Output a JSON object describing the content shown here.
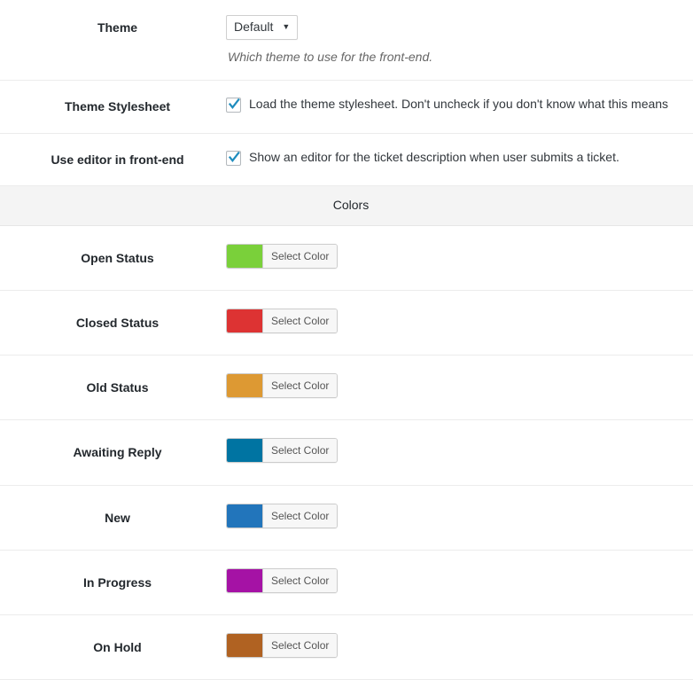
{
  "settings": {
    "theme": {
      "label": "Theme",
      "select_value": "Default",
      "caret_icon": "chevron-down-icon",
      "description": "Which theme to use for the front-end."
    },
    "theme_stylesheet": {
      "label": "Theme Stylesheet",
      "checkbox_icon": "checkmark-icon",
      "checkbox_checked": "true",
      "checkbox_label": "Load the theme stylesheet. Don't uncheck if you don't know what this means"
    },
    "use_editor": {
      "label": "Use editor in front-end",
      "checkbox_icon": "checkmark-icon",
      "checkbox_checked": "true",
      "checkbox_label": "Show an editor for the ticket description when user submits a ticket."
    }
  },
  "colors_section": {
    "title": "Colors",
    "button_label": "Select Color",
    "rows": [
      {
        "label": "Open Status",
        "color": "#7ad03a"
      },
      {
        "label": "Closed Status",
        "color": "#dd3333"
      },
      {
        "label": "Old Status",
        "color": "#dd9933"
      },
      {
        "label": "Awaiting Reply",
        "color": "#0074a2"
      },
      {
        "label": "New",
        "color": "#2275bb"
      },
      {
        "label": "In Progress",
        "color": "#a512a5"
      },
      {
        "label": "On Hold",
        "color": "#b06222"
      }
    ]
  }
}
